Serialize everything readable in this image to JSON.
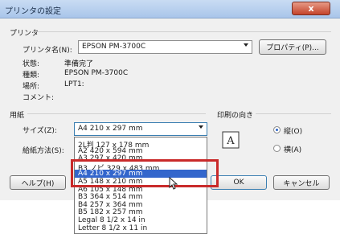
{
  "window": {
    "title": "プリンタの設定",
    "close_label": "x"
  },
  "printer_group": {
    "label": "プリンタ",
    "name_label": "プリンタ名(N):",
    "name_value": "EPSON PM-3700C",
    "properties_button": "プロパティ(P)...",
    "status_label": "状態:",
    "status_value": "準備完了",
    "type_label": "種類:",
    "type_value": "EPSON PM-3700C",
    "location_label": "場所:",
    "location_value": "LPT1:",
    "comment_label": "コメント:"
  },
  "paper_group": {
    "label": "用紙",
    "size_label": "サイズ(Z):",
    "size_value": "A4 210 x 297 mm",
    "feed_label": "給紙方法(S):"
  },
  "orientation_group": {
    "label": "印刷の向き",
    "portrait_label": "縦(O)",
    "landscape_label": "横(A)",
    "selected": "portrait"
  },
  "buttons": {
    "help": "ヘルプ(H)",
    "ok": "OK",
    "cancel": "キャンセル"
  },
  "size_options": [
    "2L判 127 x 178 mm",
    "A2 420 x 594 mm",
    "A3 297 x 420 mm",
    "B3 ノビ 329 x 483 mm",
    "A4 210 x 297 mm",
    "A5 148 x 210 mm",
    "A6 105 x 148 mm",
    "B3 364 x 514 mm",
    "B4 257 x 364 mm",
    "B5 182 x 257 mm",
    "Legal 8 1/2 x 14 in",
    "Letter 8 1/2 x 11 in"
  ],
  "selected_size_index": 4,
  "colors": {
    "highlight": "#c92a2a",
    "selection": "#3366cc"
  }
}
